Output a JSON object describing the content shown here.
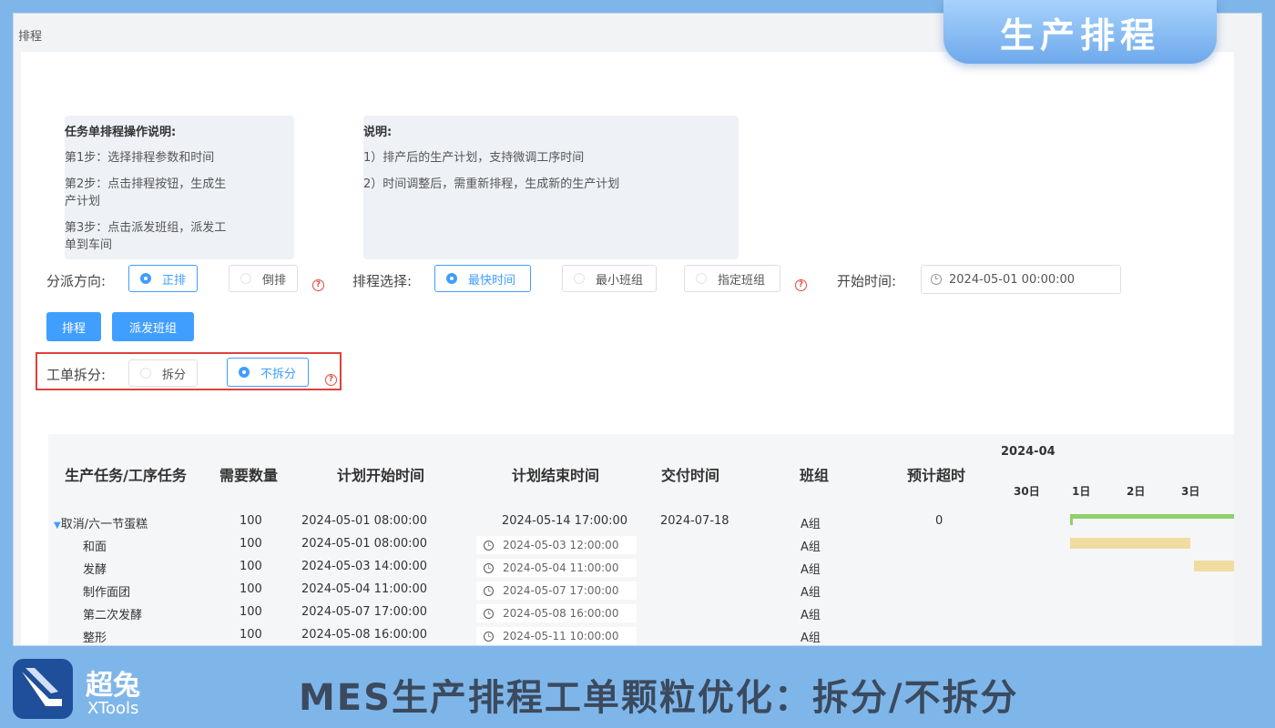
{
  "badge": "生产排程",
  "breadcrumb": "排程",
  "instructions": {
    "title": "任务单排程操作说明:",
    "steps": [
      "第1步：选择排程参数和时间",
      "第2步：点击排程按钮，生成生",
      "产计划",
      "第3步：点击派发班组，派发工",
      "单到车间"
    ]
  },
  "notes": {
    "title": "说明:",
    "items": [
      "1）排产后的生产计划，支持微调工序时间",
      "2）时间调整后，需重新排程，生成新的生产计划"
    ]
  },
  "dispatch": {
    "label": "分派方向:",
    "options": [
      "正排",
      "倒排"
    ],
    "selected": "正排"
  },
  "schedule_choice": {
    "label": "排程选择:",
    "options": [
      "最快时间",
      "最小班组",
      "指定班组"
    ],
    "selected": "最快时间"
  },
  "start_time": {
    "label": "开始时间:",
    "value": "2024-05-01 00:00:00"
  },
  "buttons": {
    "schedule": "排程",
    "dispatch_team": "派发班组"
  },
  "split": {
    "label": "工单拆分:",
    "options": [
      "拆分",
      "不拆分"
    ],
    "selected": "不拆分"
  },
  "table": {
    "headers": [
      "生产任务/工序任务",
      "需要数量",
      "计划开始时间",
      "计划结束时间",
      "交付时间",
      "班组",
      "预计超时"
    ],
    "gantt_month": "2024-04",
    "gantt_days": [
      "30日",
      "1日",
      "2日",
      "3日"
    ],
    "parent": {
      "name": "取消/六一节蛋糕",
      "qty": "100",
      "start": "2024-05-01 08:00:00",
      "end": "2024-05-14 17:00:00",
      "delivery": "2024-07-18",
      "team": "A组",
      "overtime": "0"
    },
    "rows": [
      {
        "name": "和面",
        "qty": "100",
        "start": "2024-05-01 08:00:00",
        "end": "2024-05-03 12:00:00",
        "team": "A组"
      },
      {
        "name": "发酵",
        "qty": "100",
        "start": "2024-05-03 14:00:00",
        "end": "2024-05-04 11:00:00",
        "team": "A组"
      },
      {
        "name": "制作面团",
        "qty": "100",
        "start": "2024-05-04 11:00:00",
        "end": "2024-05-07 17:00:00",
        "team": "A组"
      },
      {
        "name": "第二次发酵",
        "qty": "100",
        "start": "2024-05-07 17:00:00",
        "end": "2024-05-08 16:00:00",
        "team": "A组"
      },
      {
        "name": "整形",
        "qty": "100",
        "start": "2024-05-08 16:00:00",
        "end": "2024-05-11 10:00:00",
        "team": "A组"
      }
    ]
  },
  "colors": {
    "primary": "#409eff",
    "gantt_parent": "#8fd16a",
    "gantt_task": "#f1dca0",
    "highlight_border": "#e0413a"
  },
  "brand": {
    "name": "超兔",
    "sub": "XTools"
  },
  "banner": "MES生产排程工单颗粒优化：拆分/不拆分"
}
